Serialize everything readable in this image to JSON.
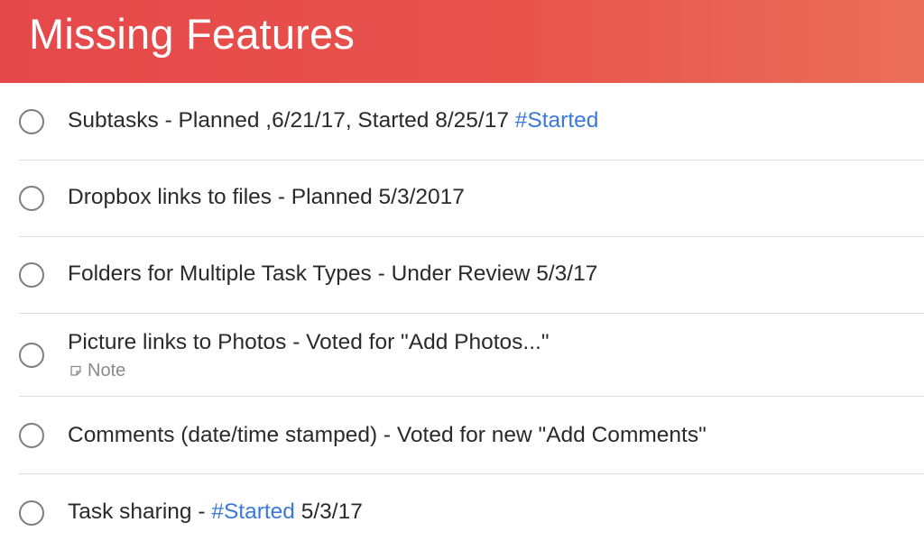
{
  "header": {
    "title": "Missing Features"
  },
  "tasks": [
    {
      "text": "Subtasks - Planned ,6/21/17, Started 8/25/17 ",
      "tag": "#Started",
      "suffix": ""
    },
    {
      "text": "Dropbox links to files - Planned 5/3/2017",
      "tag": "",
      "suffix": ""
    },
    {
      "text": "Folders for Multiple Task Types - Under Review 5/3/17",
      "tag": "",
      "suffix": ""
    },
    {
      "text": "Picture links to Photos - Voted for \"Add Photos...\"",
      "tag": "",
      "suffix": "",
      "note": "Note"
    },
    {
      "text": "Comments (date/time stamped) - Voted for new \"Add Comments\"",
      "tag": "",
      "suffix": ""
    },
    {
      "text": "Task sharing - ",
      "tag": "#Started",
      "suffix": " 5/3/17"
    }
  ],
  "colors": {
    "accent": "#e5484a",
    "tag": "#3a79d9",
    "text": "#2a2a2c",
    "muted": "#8a8a8f"
  },
  "icons": {
    "checkbox": "circle-checkbox-icon",
    "note": "note-icon"
  }
}
